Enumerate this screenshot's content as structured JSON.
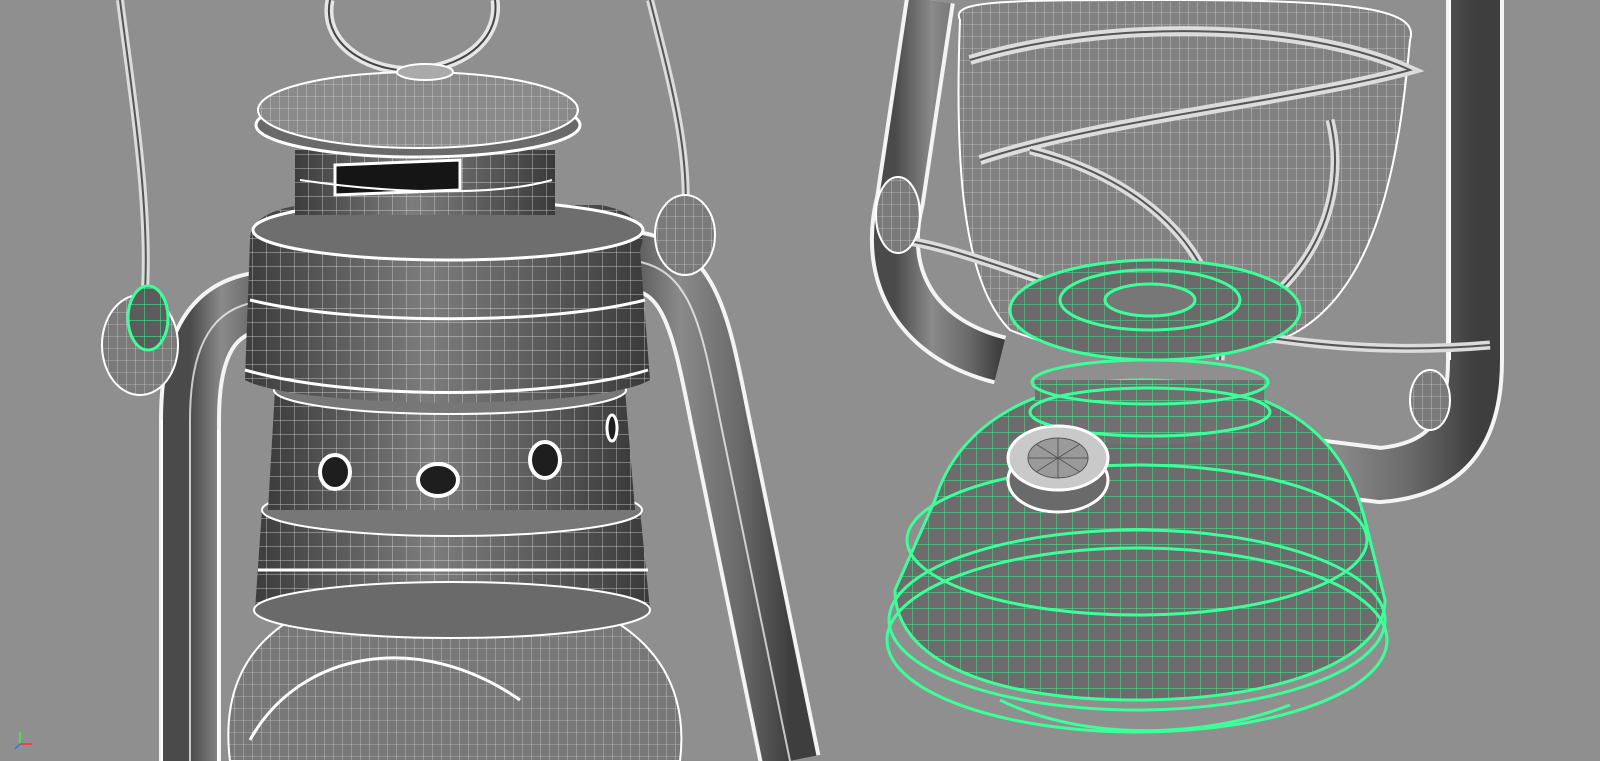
{
  "app": {
    "type": "3d-modeling-viewport",
    "background_color": "#8f8f8f"
  },
  "viewports": [
    {
      "id": "left",
      "subject": "lantern-top-closeup"
    },
    {
      "id": "right",
      "subject": "lantern-base-closeup"
    }
  ],
  "selection": {
    "highlight_color": "#3dff9a",
    "selected_parts": [
      "hanger-ring-left",
      "fuel-tank-base",
      "burner-collar"
    ]
  },
  "wireframe": {
    "edge_color": "#ffffff",
    "shaded_color": "#6e6e6e"
  },
  "axis_indicator": {
    "icon": "xyz-axis-icon",
    "x_color": "#ff3030",
    "y_color": "#30ff30",
    "z_color": "#3070ff"
  }
}
